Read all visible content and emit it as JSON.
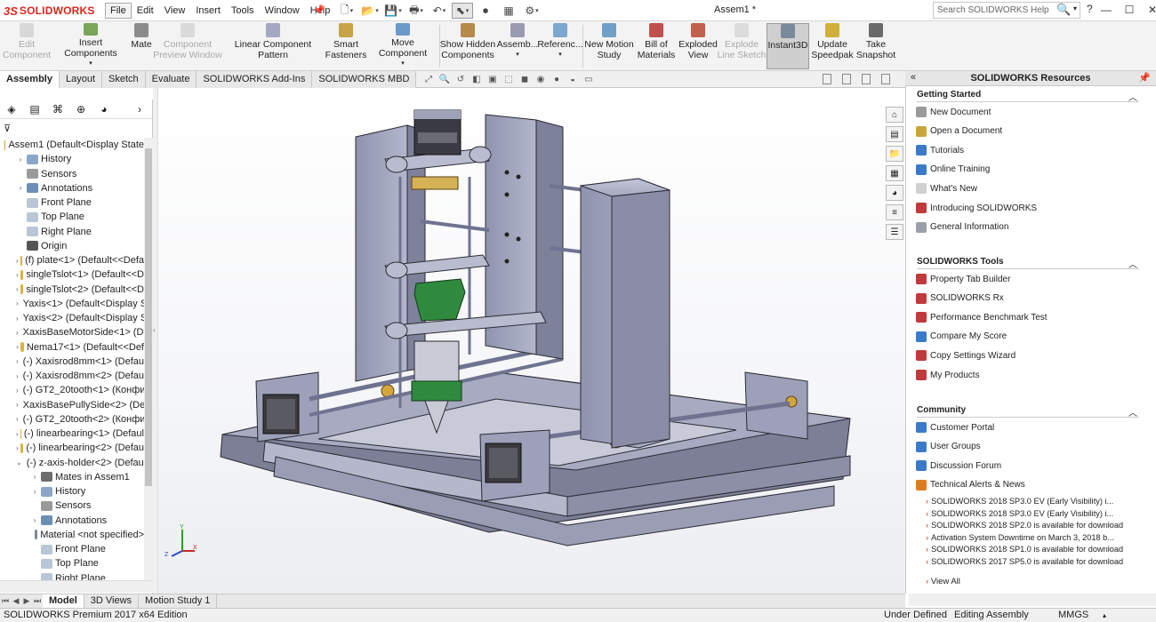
{
  "app": {
    "logo_ds": "3S",
    "logo_name": "SOLIDWORKS",
    "doc_title": "Assem1 *"
  },
  "menus": [
    "File",
    "Edit",
    "View",
    "Insert",
    "Tools",
    "Window",
    "Help"
  ],
  "search": {
    "placeholder": "Search SOLIDWORKS Help"
  },
  "ribbon": {
    "edit_component": "Edit\nComponent",
    "insert_components": "Insert Components",
    "mate": "Mate",
    "component_preview": "Component\nPreview Window",
    "linear_pattern": "Linear Component Pattern",
    "smart_fasteners": "Smart\nFasteners",
    "move_component": "Move Component",
    "show_hidden": "Show Hidden\nComponents",
    "assembly": "Assemb...",
    "reference": "Referenc...",
    "new_motion": "New Motion\nStudy",
    "bom": "Bill of\nMaterials",
    "exploded": "Exploded\nView",
    "explode_line": "Explode\nLine Sketch",
    "instant3d": "Instant3D",
    "update_speedpak": "Update\nSpeedpak",
    "take_snapshot": "Take\nSnapshot"
  },
  "cm_tabs": [
    "Assembly",
    "Layout",
    "Sketch",
    "Evaluate",
    "SOLIDWORKS Add-Ins",
    "SOLIDWORKS MBD"
  ],
  "tree": [
    {
      "label": "Assem1  (Default<Display State",
      "indent": 0,
      "exp": "",
      "color": "#d9a22a"
    },
    {
      "label": "History",
      "indent": 1,
      "exp": "›",
      "color": "#8aa7c9"
    },
    {
      "label": "Sensors",
      "indent": 1,
      "exp": "",
      "color": "#9a9a9a"
    },
    {
      "label": "Annotations",
      "indent": 1,
      "exp": "›",
      "color": "#6d8fb5"
    },
    {
      "label": "Front Plane",
      "indent": 1,
      "exp": "",
      "color": "#b9c6d6"
    },
    {
      "label": "Top Plane",
      "indent": 1,
      "exp": "",
      "color": "#b9c6d6"
    },
    {
      "label": "Right Plane",
      "indent": 1,
      "exp": "",
      "color": "#b9c6d6"
    },
    {
      "label": "Origin",
      "indent": 1,
      "exp": "",
      "color": "#555555"
    },
    {
      "label": "(f) plate<1> (Default<<Defa",
      "indent": 1,
      "exp": "›",
      "color": "#e0b13a"
    },
    {
      "label": "singleTslot<1> (Default<<D",
      "indent": 1,
      "exp": "›",
      "color": "#e0b13a"
    },
    {
      "label": "singleTslot<2> (Default<<D",
      "indent": 1,
      "exp": "›",
      "color": "#e0b13a"
    },
    {
      "label": "Yaxis<1> (Default<Display S",
      "indent": 1,
      "exp": "›",
      "color": "#e0b13a"
    },
    {
      "label": "Yaxis<2> (Default<Display S",
      "indent": 1,
      "exp": "›",
      "color": "#e0b13a"
    },
    {
      "label": "XaxisBaseMotorSide<1> (De",
      "indent": 1,
      "exp": "›",
      "color": "#e0b13a"
    },
    {
      "label": "Nema17<1> (Default<<Def",
      "indent": 1,
      "exp": "›",
      "color": "#e0b13a"
    },
    {
      "label": "(-) Xaxisrod8mm<1> (Defau",
      "indent": 1,
      "exp": "›",
      "color": "#e0b13a"
    },
    {
      "label": "(-) Xaxisrod8mm<2> (Defau",
      "indent": 1,
      "exp": "›",
      "color": "#e0b13a"
    },
    {
      "label": "(-) GT2_20tooth<1> (Конфи",
      "indent": 1,
      "exp": "›",
      "color": "#e0b13a"
    },
    {
      "label": "XaxisBasePullySide<2> (Def",
      "indent": 1,
      "exp": "›",
      "color": "#e0b13a"
    },
    {
      "label": "(-) GT2_20tooth<2> (Конфи",
      "indent": 1,
      "exp": "›",
      "color": "#e0b13a"
    },
    {
      "label": "(-) linearbearing<1> (Defaul",
      "indent": 1,
      "exp": "›",
      "color": "#e0b13a"
    },
    {
      "label": "(-) linearbearing<2> (Defau",
      "indent": 1,
      "exp": "›",
      "color": "#e0b13a"
    },
    {
      "label": "(-) z-axis-holder<2> (Defaul",
      "indent": 1,
      "exp": "⌄",
      "color": "#e0b13a"
    },
    {
      "label": "Mates in Assem1",
      "indent": 2,
      "exp": "›",
      "color": "#6d6d6d"
    },
    {
      "label": "History",
      "indent": 2,
      "exp": "›",
      "color": "#8aa7c9"
    },
    {
      "label": "Sensors",
      "indent": 2,
      "exp": "",
      "color": "#9a9a9a"
    },
    {
      "label": "Annotations",
      "indent": 2,
      "exp": "›",
      "color": "#6d8fb5"
    },
    {
      "label": "Material <not specified>",
      "indent": 2,
      "exp": "",
      "color": "#7d8a99"
    },
    {
      "label": "Front Plane",
      "indent": 2,
      "exp": "",
      "color": "#b9c6d6"
    },
    {
      "label": "Top Plane",
      "indent": 2,
      "exp": "",
      "color": "#b9c6d6"
    },
    {
      "label": "Right Plane",
      "indent": 2,
      "exp": "",
      "color": "#b9c6d6"
    }
  ],
  "bottom_tabs": [
    "Model",
    "3D Views",
    "Motion Study 1"
  ],
  "triad": {
    "y": "Y",
    "x": "X",
    "z": "Z"
  },
  "resources": {
    "title": "SOLIDWORKS Resources",
    "getting_started": "Getting Started",
    "gs_items": [
      "New Document",
      "Open a Document",
      "Tutorials",
      "Online Training",
      "What's New",
      "Introducing SOLIDWORKS",
      "General Information"
    ],
    "tools": "SOLIDWORKS Tools",
    "tool_items": [
      "Property Tab Builder",
      "SOLIDWORKS Rx",
      "Performance Benchmark Test",
      "Compare My Score",
      "Copy Settings Wizard",
      "My Products"
    ],
    "community": "Community",
    "comm_items": [
      "Customer Portal",
      "User Groups",
      "Discussion Forum",
      "Technical Alerts & News"
    ],
    "news": [
      "SOLIDWORKS 2018 SP3.0 EV (Early Visibility) i...",
      "SOLIDWORKS 2018 SP3.0 EV (Early Visibility) i...",
      "SOLIDWORKS 2018 SP2.0 is available for download",
      "Activation System Downtime on March 3, 2018 b...",
      "SOLIDWORKS 2018 SP1.0 is available for download",
      "SOLIDWORKS 2017 SP5.0 is available for download"
    ],
    "view_all": "View All"
  },
  "status": {
    "edition": "SOLIDWORKS Premium 2017 x64 Edition",
    "defined": "Under Defined",
    "mode": "Editing Assembly",
    "units": "MMGS"
  },
  "colors": {
    "brand": "#d9261c",
    "metal": "#9fa3bd",
    "green": "#2f8a3e"
  }
}
